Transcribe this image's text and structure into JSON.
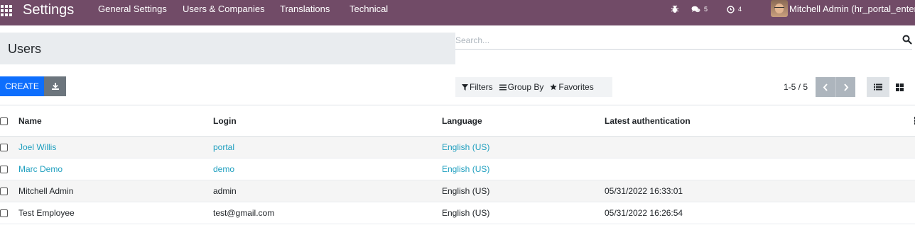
{
  "navbar": {
    "brand": "Settings",
    "menu": [
      "General Settings",
      "Users & Companies",
      "Translations",
      "Technical"
    ],
    "messages_count": "5",
    "activities_count": "4",
    "user_name": "Mitchell Admin (hr_portal_enter)"
  },
  "control_panel": {
    "title": "Users",
    "search_placeholder": "Search...",
    "create_label": "CREATE",
    "filters_label": "Filters",
    "group_by_label": "Group By",
    "favorites_label": "Favorites",
    "pager": "1-5 / 5"
  },
  "table": {
    "columns": [
      "Name",
      "Login",
      "Language",
      "Latest authentication"
    ],
    "rows": [
      {
        "name": "Joel Willis",
        "login": "portal",
        "language": "English (US)",
        "latest_auth": ""
      },
      {
        "name": "Marc Demo",
        "login": "demo",
        "language": "English (US)",
        "latest_auth": ""
      },
      {
        "name": "Mitchell Admin",
        "login": "admin",
        "language": "English (US)",
        "latest_auth": "05/31/2022 16:33:01"
      },
      {
        "name": "Test Employee",
        "login": "test@gmail.com",
        "language": "English (US)",
        "latest_auth": "05/31/2022 16:26:54"
      }
    ]
  },
  "colors": {
    "navbar_bg": "#714B67",
    "primary": "#0d6efd",
    "link": "#1f9fbf"
  }
}
